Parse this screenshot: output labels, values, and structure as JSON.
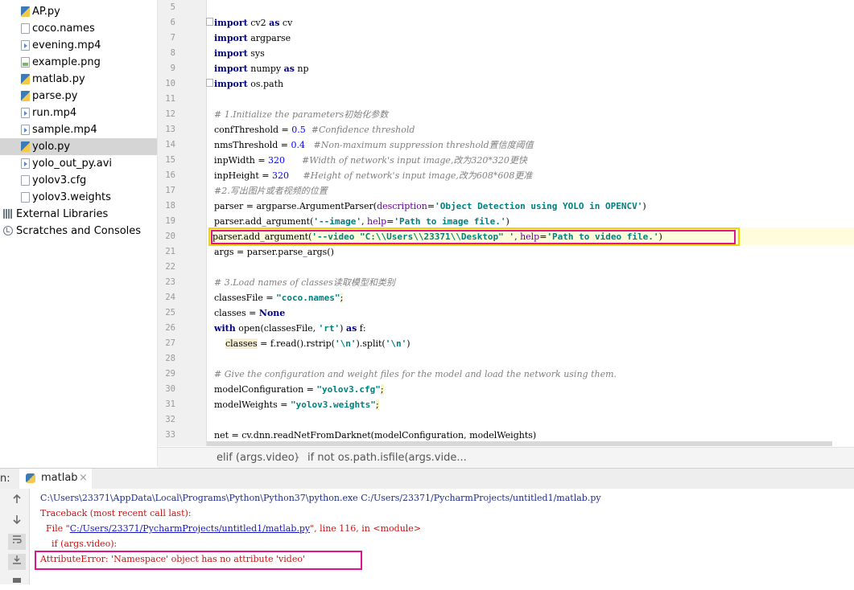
{
  "project_tree": {
    "items": [
      {
        "label": "AP.py",
        "icon": "python-file-icon"
      },
      {
        "label": "coco.names",
        "icon": "text-file-icon"
      },
      {
        "label": "evening.mp4",
        "icon": "video-file-icon"
      },
      {
        "label": "example.png",
        "icon": "image-file-icon"
      },
      {
        "label": "matlab.py",
        "icon": "python-file-icon"
      },
      {
        "label": "parse.py",
        "icon": "python-file-icon"
      },
      {
        "label": "run.mp4",
        "icon": "video-file-icon"
      },
      {
        "label": "sample.mp4",
        "icon": "video-file-icon"
      },
      {
        "label": "yolo.py",
        "icon": "python-file-icon",
        "selected": true
      },
      {
        "label": "yolo_out_py.avi",
        "icon": "video-file-icon"
      },
      {
        "label": "yolov3.cfg",
        "icon": "text-file-icon"
      },
      {
        "label": "yolov3.weights",
        "icon": "text-file-icon"
      }
    ],
    "external_libraries": "External Libraries",
    "scratches": "Scratches and Consoles"
  },
  "editor": {
    "line_numbers": [
      "5",
      "6",
      "7",
      "8",
      "9",
      "10",
      "11",
      "12",
      "13",
      "14",
      "15",
      "16",
      "17",
      "18",
      "19",
      "20",
      "21",
      "22",
      "23",
      "24",
      "25",
      "26",
      "27",
      "28",
      "29",
      "30",
      "31",
      "32",
      "33"
    ],
    "code": {
      "l6_kw": "import",
      "l6_rest": " cv2 ",
      "l6_as": "as",
      "l6_tail": " cv",
      "l7_kw": "import",
      "l7_rest": " argparse",
      "l8_kw": "import",
      "l8_rest": " sys",
      "l9_kw": "import",
      "l9_rest": " numpy ",
      "l9_as": "as",
      "l9_tail": " np",
      "l10_kw": "import",
      "l10_rest": " os.path",
      "l12": "# 1.Initialize the parameters初始化参数",
      "l13_a": "confThreshold = ",
      "l13_num": "0.5",
      "l13_cm": "  #Confidence threshold",
      "l14_a": "nmsThreshold = ",
      "l14_num": "0.4",
      "l14_cm": "   #Non-maximum suppression threshold置信度阈值",
      "l15_a": "inpWidth = ",
      "l15_num": "320",
      "l15_cm": "      #Width of network's input image,改为320*320更快",
      "l16_a": "inpHeight = ",
      "l16_num": "320",
      "l16_cm": "     #Height of network's input image,改为608*608更准",
      "l17": "#2.写出图片或者视频的位置",
      "l18_a": "parser = argparse.ArgumentParser(",
      "l18_p": "description",
      "l18_eq": "=",
      "l18_s": "'Object Detection using YOLO in OPENCV'",
      "l18_z": ")",
      "l19_a": "parser.add_argument(",
      "l19_s1": "'--image'",
      ", ": ", ",
      "l19_p": "help",
      "l19_eq": "=",
      "l19_s2": "'Path to image file.'",
      "l19_z": ")",
      "l20_a": "parser.add_argument(",
      "l20_s1": "'--video \"C:\\\\Users\\\\23371\\\\Desktop\" '",
      "l20_c": ", ",
      "l20_p": "help",
      "l20_eq": "=",
      "l20_s2": "'Path to video file.'",
      "l20_z": ")",
      "l21": "args = parser.parse_args()",
      "l23": "# 3.Load names of classes读取模型和类别",
      "l24_a": "classesFile = ",
      "l24_s": "\"coco.names\"",
      "l24_z": ";",
      "l25_a": "classes = ",
      "l25_kw": "None",
      "l26_kw": "with",
      "l26_a": " open(classesFile, ",
      "l26_s": "'rt'",
      "l26_b": ") ",
      "l26_as": "as",
      "l26_c": " f:",
      "l27_a": "    ",
      "l27_var": "classes",
      "l27_b": " = f.read().rstrip(",
      "l27_s1": "'\\n'",
      "l27_c": ").split(",
      "l27_s2": "'\\n'",
      "l27_z": ")",
      "l29": "# Give the configuration and weight files for the model and load the network using them.",
      "l30_a": "modelConfiguration = ",
      "l30_s": "\"yolov3.cfg\"",
      "l30_z": ";",
      "l31_a": "modelWeights = ",
      "l31_s": "\"yolov3.weights\"",
      "l31_z": ";",
      "l33": "net = cv.dnn.readNetFromDarknet(modelConfiguration, modelWeights)"
    }
  },
  "breadcrumb": [
    "elif (args.video)",
    "if not os.path.isfile(args.vide..."
  ],
  "run_panel": {
    "prefix": "n:",
    "tab_label": "matlab",
    "close": "×",
    "console": {
      "cmd": "C:\\Users\\23371\\AppData\\Local\\Programs\\Python\\Python37\\python.exe C:/Users/23371/PycharmProjects/untitled1/matlab.py",
      "traceback": "Traceback (most recent call last):",
      "file_pre": "  File \"",
      "file_link": "C:/Users/23371/PycharmProjects/untitled1/matlab.py",
      "file_post": "\", line 116, in <module>",
      "if_line": "    if (args.video):",
      "error": "AttributeError: 'Namespace' object has no attribute 'video'"
    }
  },
  "colors": {
    "highlight_yellow": "#f2d200",
    "highlight_pink": "#e0148c",
    "error_red": "#c81414"
  }
}
